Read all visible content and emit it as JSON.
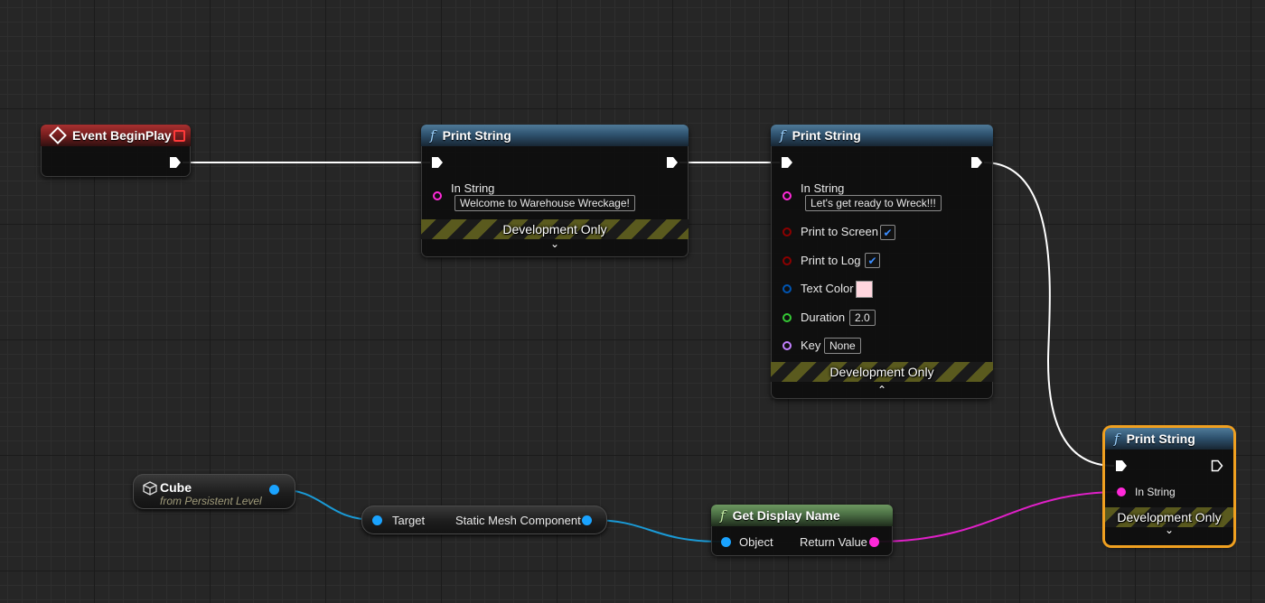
{
  "colors": {
    "exec_wire": "#ffffff",
    "object_wire": "#1a9ad6",
    "string_wire": "#e020c8",
    "string_pin": "#ff29d9",
    "object_pin": "#1aa3ff",
    "bool_pin": "#8c0000",
    "struct_pin": "#0055b3",
    "float_pin": "#35c935",
    "name_pin": "#c280ff",
    "selection": "#f0a020"
  },
  "event_node": {
    "title": "Event BeginPlay",
    "icon": "event-diamond-icon"
  },
  "print1": {
    "title": "Print String",
    "in_string_label": "In String",
    "in_string_value": "Welcome to Warehouse Wreckage!",
    "dev_label": "Development Only",
    "chevron": "⌄"
  },
  "print2": {
    "title": "Print String",
    "in_string_label": "In String",
    "in_string_value": "Let's get ready to Wreck!!!",
    "print_screen_label": "Print to Screen",
    "print_screen_checked": true,
    "print_log_label": "Print to Log",
    "print_log_checked": true,
    "text_color_label": "Text Color",
    "text_color_value": "#ffd6de",
    "duration_label": "Duration",
    "duration_value": "2.0",
    "key_label": "Key",
    "key_value": "None",
    "dev_label": "Development Only",
    "chevron": "⌃"
  },
  "print3": {
    "title": "Print String",
    "in_string_label": "In String",
    "dev_label": "Development Only",
    "chevron": "⌄"
  },
  "cube": {
    "title": "Cube",
    "subtitle": "from Persistent Level",
    "icon": "cube-icon"
  },
  "target_node": {
    "left_label": "Target",
    "right_label": "Static Mesh Component"
  },
  "get_display": {
    "title": "Get Display Name",
    "object_label": "Object",
    "return_label": "Return Value"
  },
  "check_glyph": "✔"
}
